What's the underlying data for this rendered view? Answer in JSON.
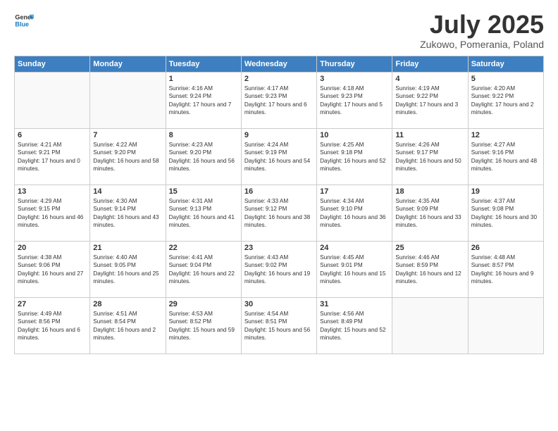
{
  "header": {
    "logo_general": "General",
    "logo_blue": "Blue",
    "month_year": "July 2025",
    "location": "Zukowo, Pomerania, Poland"
  },
  "days_of_week": [
    "Sunday",
    "Monday",
    "Tuesday",
    "Wednesday",
    "Thursday",
    "Friday",
    "Saturday"
  ],
  "weeks": [
    [
      {
        "day": "",
        "sunrise": "",
        "sunset": "",
        "daylight": ""
      },
      {
        "day": "",
        "sunrise": "",
        "sunset": "",
        "daylight": ""
      },
      {
        "day": "1",
        "sunrise": "Sunrise: 4:16 AM",
        "sunset": "Sunset: 9:24 PM",
        "daylight": "Daylight: 17 hours and 7 minutes."
      },
      {
        "day": "2",
        "sunrise": "Sunrise: 4:17 AM",
        "sunset": "Sunset: 9:23 PM",
        "daylight": "Daylight: 17 hours and 6 minutes."
      },
      {
        "day": "3",
        "sunrise": "Sunrise: 4:18 AM",
        "sunset": "Sunset: 9:23 PM",
        "daylight": "Daylight: 17 hours and 5 minutes."
      },
      {
        "day": "4",
        "sunrise": "Sunrise: 4:19 AM",
        "sunset": "Sunset: 9:22 PM",
        "daylight": "Daylight: 17 hours and 3 minutes."
      },
      {
        "day": "5",
        "sunrise": "Sunrise: 4:20 AM",
        "sunset": "Sunset: 9:22 PM",
        "daylight": "Daylight: 17 hours and 2 minutes."
      }
    ],
    [
      {
        "day": "6",
        "sunrise": "Sunrise: 4:21 AM",
        "sunset": "Sunset: 9:21 PM",
        "daylight": "Daylight: 17 hours and 0 minutes."
      },
      {
        "day": "7",
        "sunrise": "Sunrise: 4:22 AM",
        "sunset": "Sunset: 9:20 PM",
        "daylight": "Daylight: 16 hours and 58 minutes."
      },
      {
        "day": "8",
        "sunrise": "Sunrise: 4:23 AM",
        "sunset": "Sunset: 9:20 PM",
        "daylight": "Daylight: 16 hours and 56 minutes."
      },
      {
        "day": "9",
        "sunrise": "Sunrise: 4:24 AM",
        "sunset": "Sunset: 9:19 PM",
        "daylight": "Daylight: 16 hours and 54 minutes."
      },
      {
        "day": "10",
        "sunrise": "Sunrise: 4:25 AM",
        "sunset": "Sunset: 9:18 PM",
        "daylight": "Daylight: 16 hours and 52 minutes."
      },
      {
        "day": "11",
        "sunrise": "Sunrise: 4:26 AM",
        "sunset": "Sunset: 9:17 PM",
        "daylight": "Daylight: 16 hours and 50 minutes."
      },
      {
        "day": "12",
        "sunrise": "Sunrise: 4:27 AM",
        "sunset": "Sunset: 9:16 PM",
        "daylight": "Daylight: 16 hours and 48 minutes."
      }
    ],
    [
      {
        "day": "13",
        "sunrise": "Sunrise: 4:29 AM",
        "sunset": "Sunset: 9:15 PM",
        "daylight": "Daylight: 16 hours and 46 minutes."
      },
      {
        "day": "14",
        "sunrise": "Sunrise: 4:30 AM",
        "sunset": "Sunset: 9:14 PM",
        "daylight": "Daylight: 16 hours and 43 minutes."
      },
      {
        "day": "15",
        "sunrise": "Sunrise: 4:31 AM",
        "sunset": "Sunset: 9:13 PM",
        "daylight": "Daylight: 16 hours and 41 minutes."
      },
      {
        "day": "16",
        "sunrise": "Sunrise: 4:33 AM",
        "sunset": "Sunset: 9:12 PM",
        "daylight": "Daylight: 16 hours and 38 minutes."
      },
      {
        "day": "17",
        "sunrise": "Sunrise: 4:34 AM",
        "sunset": "Sunset: 9:10 PM",
        "daylight": "Daylight: 16 hours and 36 minutes."
      },
      {
        "day": "18",
        "sunrise": "Sunrise: 4:35 AM",
        "sunset": "Sunset: 9:09 PM",
        "daylight": "Daylight: 16 hours and 33 minutes."
      },
      {
        "day": "19",
        "sunrise": "Sunrise: 4:37 AM",
        "sunset": "Sunset: 9:08 PM",
        "daylight": "Daylight: 16 hours and 30 minutes."
      }
    ],
    [
      {
        "day": "20",
        "sunrise": "Sunrise: 4:38 AM",
        "sunset": "Sunset: 9:06 PM",
        "daylight": "Daylight: 16 hours and 27 minutes."
      },
      {
        "day": "21",
        "sunrise": "Sunrise: 4:40 AM",
        "sunset": "Sunset: 9:05 PM",
        "daylight": "Daylight: 16 hours and 25 minutes."
      },
      {
        "day": "22",
        "sunrise": "Sunrise: 4:41 AM",
        "sunset": "Sunset: 9:04 PM",
        "daylight": "Daylight: 16 hours and 22 minutes."
      },
      {
        "day": "23",
        "sunrise": "Sunrise: 4:43 AM",
        "sunset": "Sunset: 9:02 PM",
        "daylight": "Daylight: 16 hours and 19 minutes."
      },
      {
        "day": "24",
        "sunrise": "Sunrise: 4:45 AM",
        "sunset": "Sunset: 9:01 PM",
        "daylight": "Daylight: 16 hours and 15 minutes."
      },
      {
        "day": "25",
        "sunrise": "Sunrise: 4:46 AM",
        "sunset": "Sunset: 8:59 PM",
        "daylight": "Daylight: 16 hours and 12 minutes."
      },
      {
        "day": "26",
        "sunrise": "Sunrise: 4:48 AM",
        "sunset": "Sunset: 8:57 PM",
        "daylight": "Daylight: 16 hours and 9 minutes."
      }
    ],
    [
      {
        "day": "27",
        "sunrise": "Sunrise: 4:49 AM",
        "sunset": "Sunset: 8:56 PM",
        "daylight": "Daylight: 16 hours and 6 minutes."
      },
      {
        "day": "28",
        "sunrise": "Sunrise: 4:51 AM",
        "sunset": "Sunset: 8:54 PM",
        "daylight": "Daylight: 16 hours and 2 minutes."
      },
      {
        "day": "29",
        "sunrise": "Sunrise: 4:53 AM",
        "sunset": "Sunset: 8:52 PM",
        "daylight": "Daylight: 15 hours and 59 minutes."
      },
      {
        "day": "30",
        "sunrise": "Sunrise: 4:54 AM",
        "sunset": "Sunset: 8:51 PM",
        "daylight": "Daylight: 15 hours and 56 minutes."
      },
      {
        "day": "31",
        "sunrise": "Sunrise: 4:56 AM",
        "sunset": "Sunset: 8:49 PM",
        "daylight": "Daylight: 15 hours and 52 minutes."
      },
      {
        "day": "",
        "sunrise": "",
        "sunset": "",
        "daylight": ""
      },
      {
        "day": "",
        "sunrise": "",
        "sunset": "",
        "daylight": ""
      }
    ]
  ]
}
